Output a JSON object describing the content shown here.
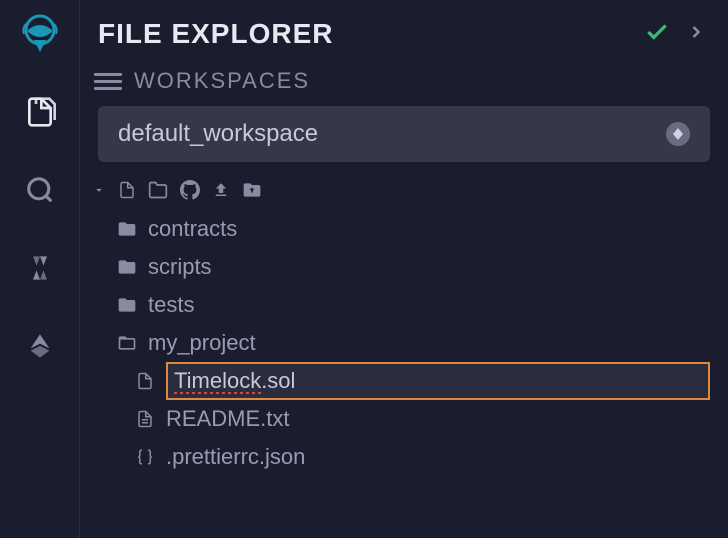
{
  "header": {
    "title": "FILE EXPLORER"
  },
  "workspaces": {
    "section_label": "WORKSPACES",
    "selected": "default_workspace"
  },
  "tree": {
    "items": [
      {
        "label": "contracts",
        "type": "folder"
      },
      {
        "label": "scripts",
        "type": "folder"
      },
      {
        "label": "tests",
        "type": "folder"
      },
      {
        "label": "my_project",
        "type": "folder-open"
      },
      {
        "label": "Timelock.sol",
        "type": "file-editing",
        "nested": true
      },
      {
        "label": "README.txt",
        "type": "file-text",
        "nested": true
      },
      {
        "label": ".prettierrc.json",
        "type": "file-json",
        "nested": true
      }
    ]
  }
}
